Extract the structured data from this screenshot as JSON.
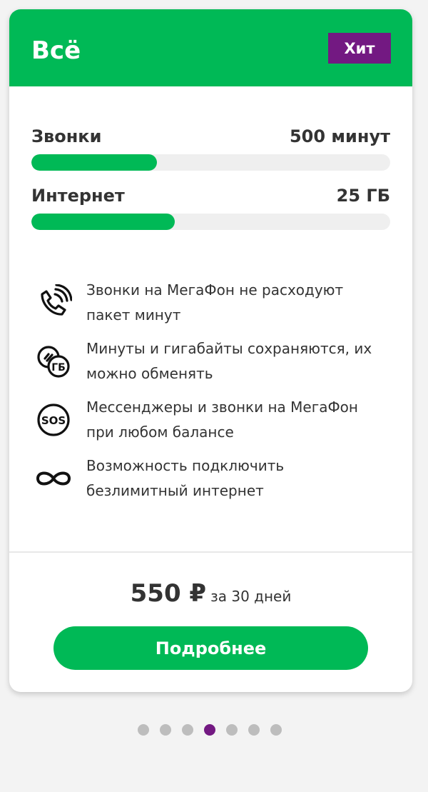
{
  "colors": {
    "brand_green": "#00b956",
    "brand_purple": "#731982",
    "dot_inactive": "#bdbdbd"
  },
  "tariff": {
    "title": "Всё",
    "badge": "Хит"
  },
  "usage": [
    {
      "label": "Звонки",
      "value": "500 минут",
      "fill_fraction": 0.35
    },
    {
      "label": "Интернет",
      "value": "25 ГБ",
      "fill_fraction": 0.4
    }
  ],
  "features": [
    {
      "icon": "phone-wave-icon",
      "text": "Звонки на МегаФон не расходуют пакет минут"
    },
    {
      "icon": "minutes-gb-exchange-icon",
      "text": "Минуты и гигабайты сохраняются, их можно обменять"
    },
    {
      "icon": "sos-icon",
      "text": "Мессенджеры и звонки на МегаФон при любом балансе"
    },
    {
      "icon": "infinity-icon",
      "text": "Возможность подключить безлимитный интернет"
    }
  ],
  "price": {
    "amount": "550 ₽",
    "period": "за 30 дней"
  },
  "button": {
    "label": "Подробнее"
  },
  "pagination": {
    "total": 7,
    "active_index": 3
  }
}
